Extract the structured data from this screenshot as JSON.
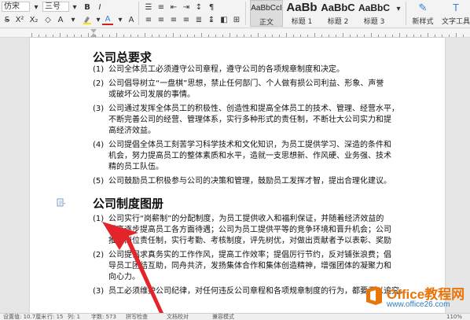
{
  "ribbon": {
    "font_name": "仿宋",
    "font_size": "三号",
    "bold_glyph": "B",
    "font_color_glyph": "A",
    "styles": [
      {
        "preview": "AaBbCcI",
        "label": "正文"
      },
      {
        "preview": "AaBb",
        "label": "标题 1"
      },
      {
        "preview": "AaBbC",
        "label": "标题 2"
      },
      {
        "preview": "AaBbC",
        "label": "标题 3"
      }
    ],
    "new_style_label": "新样式",
    "text_tools_label": "文字工具",
    "colors": {
      "highlight": "#f5e400",
      "font": "#d11f1f",
      "accent": "#3c7fd6"
    }
  },
  "document": {
    "section1_heading": "公司总要求",
    "section1_items": [
      {
        "num": "(1)",
        "lines": [
          "公司全体员工必须遵守公司章程，遵守公司的各项规章制度和决定。"
        ]
      },
      {
        "num": "(2)",
        "lines": [
          "公司倡导树立“一盘棋”思想，禁止任何部门、个人做有损公司利益、形象、声誉",
          "或破坏公司发展的事情。"
        ]
      },
      {
        "num": "(3)",
        "lines": [
          "公司通过发挥全体员工的积极性、创造性和提高全体员工的技术、管理、经营水平，",
          "不断完善公司的经营、管理体系，实行多种形式的责任制，不断壮大公司实力和提",
          "高经济效益。"
        ]
      },
      {
        "num": "(4)",
        "lines": [
          "公司提倡全体员工刻苦学习科学技术和文化知识，为员工提供学习、深造的条件和",
          "机会，努力提高员工的整体素质和水平，造就一支思想新、作风硬、业务强、技术",
          "精的员工队伍。"
        ]
      },
      {
        "num": "(5)",
        "lines": [
          "公司鼓励员工积极参与公司的决策和管理，鼓励员工发挥才智，提出合理化建议。"
        ]
      }
    ],
    "section2_heading": "公司制度图册",
    "section2_items": [
      {
        "num": "(1)",
        "lines": [
          "公司实行“岗薪制”的分配制度，为员工提供收入和福利保证，并随着经济效益的",
          "提高逐步提高员工各方面待遇；公司为员工提供平等的竞争环境和晋升机会；公司",
          "推行岗位责任制，实行考勤、考核制度，评先树优，对做出贡献者予以表彰、奖励"
        ]
      },
      {
        "num": "(2)",
        "lines": [
          "公司提倡求真务实的工作作风，提高工作效率；提倡厉行节约，反对铺张浪费；倡",
          "导员工团结互助，同舟共济，发扬集体合作和集体创造精神，增强团体的凝聚力和",
          "向心力。"
        ]
      },
      {
        "num": "(3)",
        "lines": [
          "员工必须维护公司纪律，对任何违反公司章程和各项规章制度的行为，都要予以追究。"
        ]
      }
    ]
  },
  "status": {
    "set_value": "设置值: 10.7厘米",
    "row": "行: 15",
    "col": "列: 1",
    "word_count": "字数: 573",
    "spell_check": "拼写检查",
    "doc_check": "文档校对",
    "compat": "兼容模式",
    "zoom": "110%"
  },
  "watermark": {
    "title": "Office教程网",
    "url": "www.office26.com"
  }
}
